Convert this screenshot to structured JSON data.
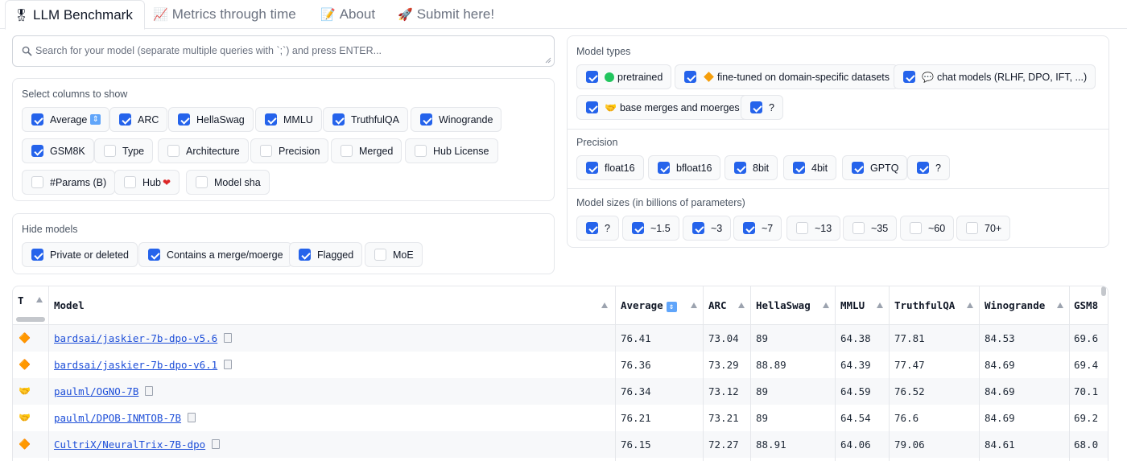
{
  "tabs": [
    {
      "icon": "🎖",
      "label": "LLM Benchmark",
      "active": true
    },
    {
      "icon": "📈",
      "label": "Metrics through time",
      "active": false
    },
    {
      "icon": "📝",
      "label": "About",
      "active": false
    },
    {
      "icon": "🚀",
      "label": "Submit here!",
      "active": false
    }
  ],
  "search": {
    "placeholder": "Search for your model (separate multiple queries with `;`) and press ENTER..."
  },
  "columns_panel": {
    "label": "Select columns to show",
    "options": [
      {
        "label": "Average",
        "checked": true
      },
      {
        "label": "ARC",
        "checked": true
      },
      {
        "label": "HellaSwag",
        "checked": true
      },
      {
        "label": "MMLU",
        "checked": true
      },
      {
        "label": "TruthfulQA",
        "checked": true
      },
      {
        "label": "Winogrande",
        "checked": true
      },
      {
        "label": "GSM8K",
        "checked": true
      },
      {
        "label": "Type",
        "checked": false
      },
      {
        "label": "Architecture",
        "checked": false
      },
      {
        "label": "Precision",
        "checked": false
      },
      {
        "label": "Merged",
        "checked": false
      },
      {
        "label": "Hub License",
        "checked": false
      },
      {
        "label": "#Params (B)",
        "checked": false
      },
      {
        "label": "Hub",
        "checked": false
      },
      {
        "label": "Model sha",
        "checked": false
      }
    ]
  },
  "hide_panel": {
    "label": "Hide models",
    "options": [
      {
        "label": "Private or deleted",
        "checked": true
      },
      {
        "label": "Contains a merge/moerge",
        "checked": true
      },
      {
        "label": "Flagged",
        "checked": true
      },
      {
        "label": "MoE",
        "checked": false
      }
    ]
  },
  "model_types": {
    "label": "Model types",
    "options": [
      {
        "label": "pretrained",
        "checked": true
      },
      {
        "label": "fine-tuned on domain-specific datasets",
        "checked": true
      },
      {
        "label": "chat models (RLHF, DPO, IFT, ...)",
        "checked": true
      },
      {
        "label": "base merges and moerges",
        "checked": true
      },
      {
        "label": "?",
        "checked": true
      }
    ]
  },
  "precision": {
    "label": "Precision",
    "options": [
      {
        "label": "float16",
        "checked": true
      },
      {
        "label": "bfloat16",
        "checked": true
      },
      {
        "label": "8bit",
        "checked": true
      },
      {
        "label": "4bit",
        "checked": true
      },
      {
        "label": "GPTQ",
        "checked": true
      },
      {
        "label": "?",
        "checked": true
      }
    ]
  },
  "model_sizes": {
    "label": "Model sizes (in billions of parameters)",
    "options": [
      {
        "label": "?",
        "checked": true
      },
      {
        "label": "~1.5",
        "checked": true
      },
      {
        "label": "~3",
        "checked": true
      },
      {
        "label": "~7",
        "checked": true
      },
      {
        "label": "~13",
        "checked": false
      },
      {
        "label": "~35",
        "checked": false
      },
      {
        "label": "~60",
        "checked": false
      },
      {
        "label": "70+",
        "checked": false
      }
    ]
  },
  "table": {
    "headers": [
      "T",
      "Model",
      "Average",
      "ARC",
      "HellaSwag",
      "MMLU",
      "TruthfulQA",
      "Winogrande",
      "GSM8"
    ],
    "rows": [
      {
        "type": "🔶",
        "model": "bardsai/jaskier-7b-dpo-v5.6",
        "values": [
          "76.41",
          "73.04",
          "89",
          "64.38",
          "77.81",
          "84.53",
          "69.6"
        ]
      },
      {
        "type": "🔶",
        "model": "bardsai/jaskier-7b-dpo-v6.1",
        "values": [
          "76.36",
          "73.29",
          "88.89",
          "64.39",
          "77.47",
          "84.69",
          "69.4"
        ]
      },
      {
        "type": "🤝",
        "model": "paulml/OGNO-7B",
        "values": [
          "76.34",
          "73.12",
          "89",
          "64.59",
          "76.52",
          "84.69",
          "70.1"
        ]
      },
      {
        "type": "🤝",
        "model": "paulml/DPOB-INMTOB-7B",
        "values": [
          "76.21",
          "73.21",
          "89",
          "64.54",
          "76.6",
          "84.69",
          "69.2"
        ]
      },
      {
        "type": "🔶",
        "model": "CultriX/NeuralTrix-7B-dpo",
        "values": [
          "76.15",
          "72.27",
          "88.91",
          "64.06",
          "79.06",
          "84.61",
          "68.0"
        ]
      }
    ]
  },
  "colors": {
    "accent": "#2563eb",
    "link": "#1d4ed8",
    "border": "#e5e7eb"
  }
}
